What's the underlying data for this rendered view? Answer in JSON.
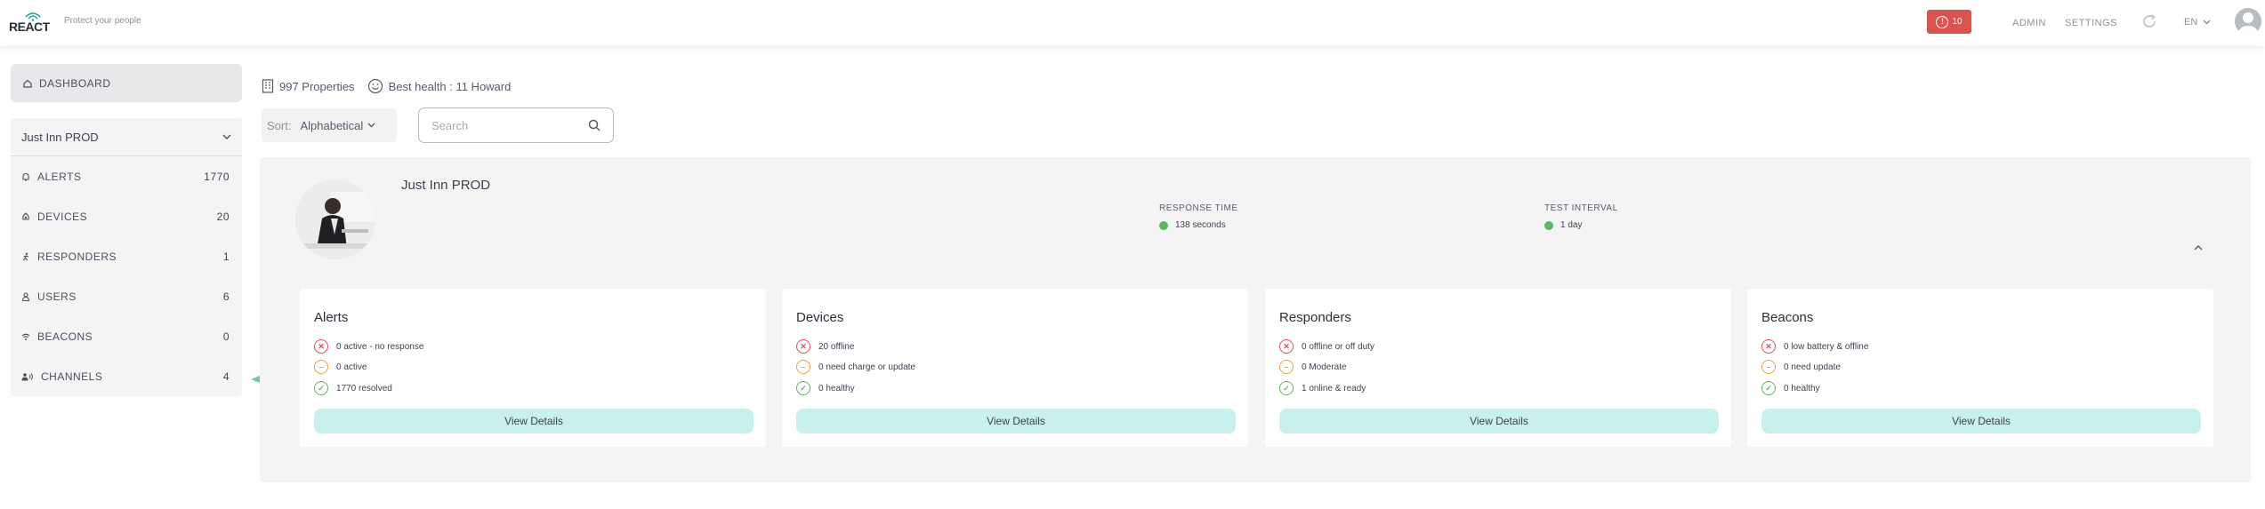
{
  "header": {
    "logo_text": "REACT",
    "tagline": "Protect your people",
    "alert_count": "10",
    "admin_label": "ADMIN",
    "settings_label": "SETTINGS",
    "language": "EN"
  },
  "sidebar": {
    "dashboard_label": "DASHBOARD",
    "org_name": "Just Inn PROD",
    "items": [
      {
        "label": "ALERTS",
        "count": "1770",
        "icon": "bell-icon"
      },
      {
        "label": "DEVICES",
        "count": "20",
        "icon": "device-icon"
      },
      {
        "label": "RESPONDERS",
        "count": "1",
        "icon": "runner-icon"
      },
      {
        "label": "USERS",
        "count": "6",
        "icon": "user-icon"
      },
      {
        "label": "BEACONS",
        "count": "0",
        "icon": "wifi-icon"
      },
      {
        "label": "CHANNELS",
        "count": "4",
        "icon": "channels-icon"
      }
    ]
  },
  "toolbar": {
    "properties": "997 Properties",
    "best_health": "Best health : 11 Howard",
    "sort_label": "Sort:",
    "sort_value": "Alphabetical",
    "search_placeholder": "Search"
  },
  "property": {
    "name": "Just Inn PROD",
    "response_time_label": "RESPONSE TIME",
    "response_time_value": "138 seconds",
    "test_interval_label": "TEST INTERVAL",
    "test_interval_value": "1 day"
  },
  "cards": [
    {
      "title": "Alerts",
      "rows": [
        {
          "status": "red",
          "text": "0 active - no response"
        },
        {
          "status": "amber",
          "text": "0 active"
        },
        {
          "status": "green",
          "text": "1770 resolved"
        }
      ],
      "button": "View Details"
    },
    {
      "title": "Devices",
      "rows": [
        {
          "status": "red",
          "text": "20 offline"
        },
        {
          "status": "amber",
          "text": "0 need charge or update"
        },
        {
          "status": "green",
          "text": "0 healthy"
        }
      ],
      "button": "View Details"
    },
    {
      "title": "Responders",
      "rows": [
        {
          "status": "red",
          "text": "0 offline or off duty"
        },
        {
          "status": "amber",
          "text": "0 Moderate"
        },
        {
          "status": "green",
          "text": "1 online & ready"
        }
      ],
      "button": "View Details"
    },
    {
      "title": "Beacons",
      "rows": [
        {
          "status": "red",
          "text": "0 low battery & offline"
        },
        {
          "status": "amber",
          "text": "0 need update"
        },
        {
          "status": "green",
          "text": "0 healthy"
        }
      ],
      "button": "View Details"
    }
  ],
  "colors": {
    "alert_red": "#d9534f",
    "warning_amber": "#e8a33c",
    "ok_green": "#5cb85c",
    "button_teal": "#c8f0ec",
    "arrow_teal": "#6fc7bb"
  }
}
